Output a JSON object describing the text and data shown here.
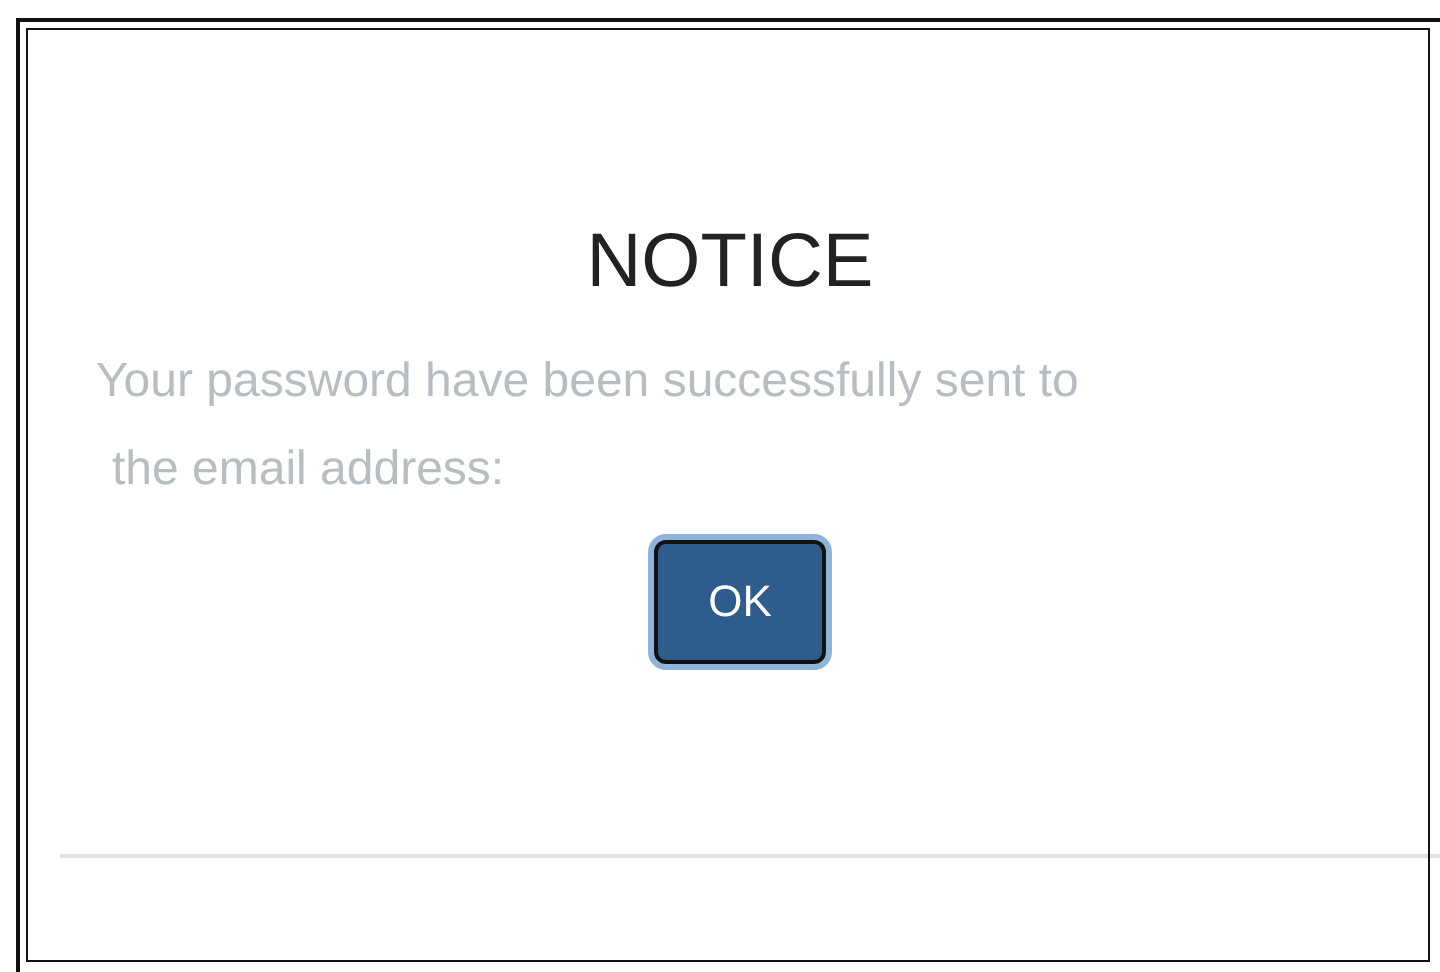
{
  "dialog": {
    "title": "NOTICE",
    "message_lines": [
      "Your password have been successfully sent to",
      "the email address:"
    ],
    "buttons": [
      {
        "label": "OK"
      }
    ]
  }
}
